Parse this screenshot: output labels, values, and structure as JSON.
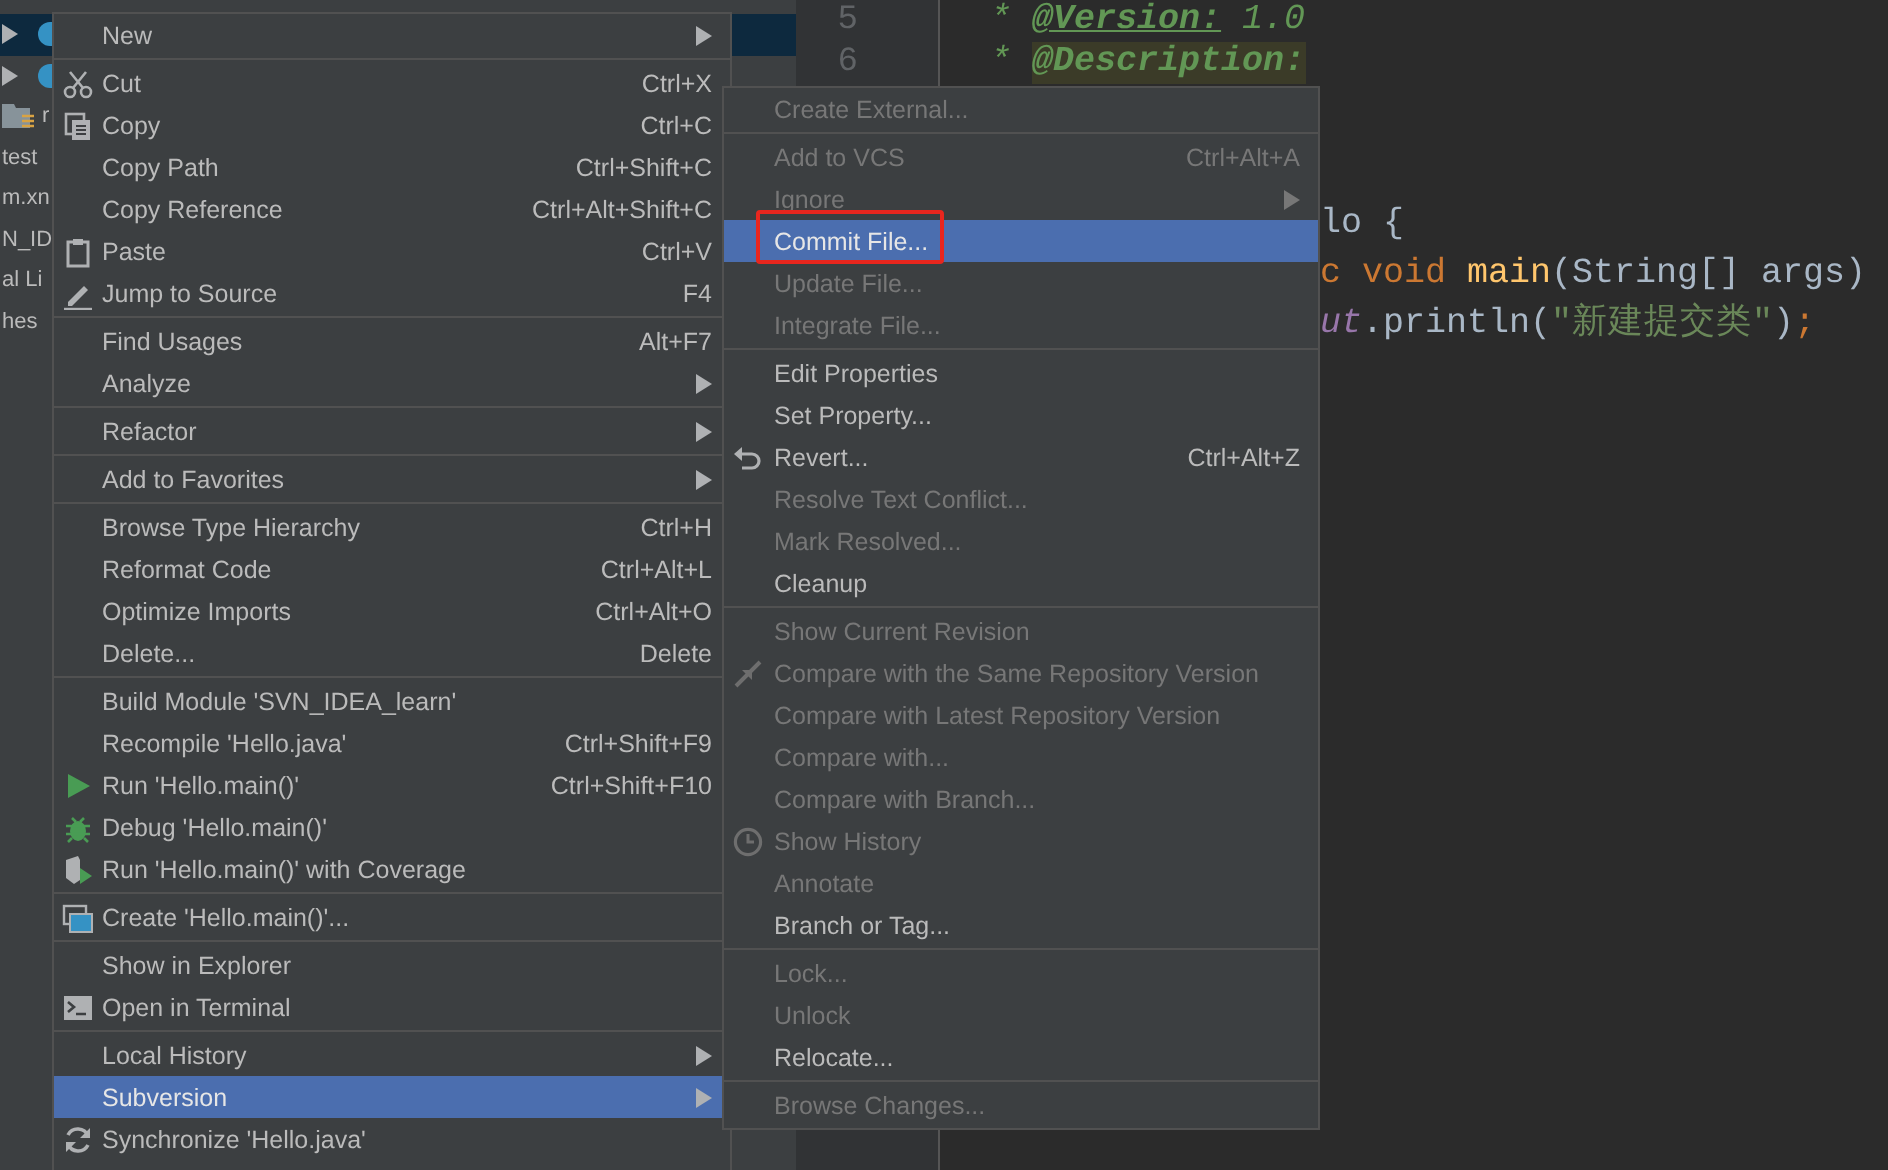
{
  "project_tree": {
    "items": [
      {
        "kind": "class",
        "expandable": true,
        "selected": true
      },
      {
        "kind": "class",
        "expandable": true,
        "selected": false
      },
      {
        "kind": "folder",
        "label": "r",
        "expandable": false,
        "selected": false
      },
      {
        "kind": "text",
        "label": "test",
        "expandable": false,
        "selected": false
      },
      {
        "kind": "text",
        "label": "m.xn",
        "expandable": false,
        "selected": false
      },
      {
        "kind": "text",
        "label": "N_ID",
        "expandable": false,
        "selected": false
      },
      {
        "kind": "text",
        "label": "al Li",
        "expandable": false,
        "selected": false
      },
      {
        "kind": "text",
        "label": "hes",
        "expandable": false,
        "selected": false
      }
    ]
  },
  "editor": {
    "line_numbers": [
      "5",
      "6"
    ],
    "lines": [
      {
        "tokens": [
          {
            "kind": "comment",
            "text": "*"
          },
          {
            "kind": "doc-tag",
            "text": "@Version:"
          },
          {
            "kind": "comment",
            "text": "1.0"
          }
        ]
      },
      {
        "tokens": [
          {
            "kind": "comment",
            "text": "*"
          },
          {
            "kind": "doc-tag-marked",
            "text": "@Description:"
          }
        ]
      },
      {
        "tokens": [
          {
            "kind": "plain",
            "text": "lo {"
          }
        ]
      },
      {
        "tokens": [
          {
            "kind": "keyword",
            "text": "c void"
          },
          {
            "kind": "function",
            "text": "main"
          },
          {
            "kind": "plain",
            "text": "(String[] args)"
          }
        ]
      },
      {
        "tokens": [
          {
            "kind": "field",
            "text": "ut"
          },
          {
            "kind": "plain",
            "text": ".println("
          },
          {
            "kind": "string",
            "text": "\"新建提交类\""
          },
          {
            "kind": "plain",
            "text": ")"
          },
          {
            "kind": "keyword",
            "text": ";"
          }
        ]
      }
    ]
  },
  "context_menu": {
    "items": [
      {
        "kind": "item",
        "label": "New",
        "submenu": true,
        "selected": false,
        "disabled": false
      },
      {
        "kind": "separator"
      },
      {
        "kind": "cut",
        "label": "Cut",
        "shortcut": "Ctrl+X",
        "submenu": false,
        "selected": false,
        "disabled": false
      },
      {
        "kind": "copy",
        "label": "Copy",
        "shortcut": "Ctrl+C",
        "submenu": false,
        "selected": false,
        "disabled": false
      },
      {
        "kind": "item",
        "label": "Copy Path",
        "shortcut": "Ctrl+Shift+C",
        "submenu": false,
        "selected": false,
        "disabled": false
      },
      {
        "kind": "item",
        "label": "Copy Reference",
        "shortcut": "Ctrl+Alt+Shift+C",
        "submenu": false,
        "selected": false,
        "disabled": false
      },
      {
        "kind": "paste",
        "label": "Paste",
        "shortcut": "Ctrl+V",
        "submenu": false,
        "selected": false,
        "disabled": false
      },
      {
        "kind": "edit",
        "label": "Jump to Source",
        "shortcut": "F4",
        "submenu": false,
        "selected": false,
        "disabled": false
      },
      {
        "kind": "separator"
      },
      {
        "kind": "item",
        "label": "Find Usages",
        "shortcut": "Alt+F7",
        "submenu": false,
        "selected": false,
        "disabled": false
      },
      {
        "kind": "item",
        "label": "Analyze",
        "submenu": true,
        "selected": false,
        "disabled": false
      },
      {
        "kind": "separator"
      },
      {
        "kind": "item",
        "label": "Refactor",
        "submenu": true,
        "selected": false,
        "disabled": false
      },
      {
        "kind": "separator"
      },
      {
        "kind": "item",
        "label": "Add to Favorites",
        "submenu": true,
        "selected": false,
        "disabled": false
      },
      {
        "kind": "separator"
      },
      {
        "kind": "item",
        "label": "Browse Type Hierarchy",
        "shortcut": "Ctrl+H",
        "submenu": false,
        "selected": false,
        "disabled": false
      },
      {
        "kind": "item",
        "label": "Reformat Code",
        "shortcut": "Ctrl+Alt+L",
        "submenu": false,
        "selected": false,
        "disabled": false
      },
      {
        "kind": "item",
        "label": "Optimize Imports",
        "shortcut": "Ctrl+Alt+O",
        "submenu": false,
        "selected": false,
        "disabled": false
      },
      {
        "kind": "item",
        "label": "Delete...",
        "shortcut": "Delete",
        "submenu": false,
        "selected": false,
        "disabled": false
      },
      {
        "kind": "separator"
      },
      {
        "kind": "item",
        "label": "Build Module 'SVN_IDEA_learn'",
        "submenu": false,
        "selected": false,
        "disabled": false
      },
      {
        "kind": "item",
        "label": "Recompile 'Hello.java'",
        "shortcut": "Ctrl+Shift+F9",
        "submenu": false,
        "selected": false,
        "disabled": false
      },
      {
        "kind": "run",
        "label": "Run 'Hello.main()'",
        "shortcut": "Ctrl+Shift+F10",
        "submenu": false,
        "selected": false,
        "disabled": false
      },
      {
        "kind": "debug",
        "label": "Debug 'Hello.main()'",
        "submenu": false,
        "selected": false,
        "disabled": false
      },
      {
        "kind": "coverage",
        "label": "Run 'Hello.main()' with Coverage",
        "submenu": false,
        "selected": false,
        "disabled": false
      },
      {
        "kind": "separator"
      },
      {
        "kind": "create",
        "label": "Create 'Hello.main()'...",
        "submenu": false,
        "selected": false,
        "disabled": false
      },
      {
        "kind": "separator"
      },
      {
        "kind": "item",
        "label": "Show in Explorer",
        "submenu": false,
        "selected": false,
        "disabled": false
      },
      {
        "kind": "terminal",
        "label": "Open in Terminal",
        "submenu": false,
        "selected": false,
        "disabled": false
      },
      {
        "kind": "separator"
      },
      {
        "kind": "item",
        "label": "Local History",
        "submenu": true,
        "selected": false,
        "disabled": false
      },
      {
        "kind": "item",
        "label": "Subversion",
        "submenu": true,
        "selected": true,
        "disabled": false
      },
      {
        "kind": "sync",
        "label": "Synchronize 'Hello.java'",
        "submenu": false,
        "selected": false,
        "disabled": false
      }
    ]
  },
  "subversion_menu": {
    "items": [
      {
        "kind": "item",
        "label": "Create External...",
        "submenu": false,
        "selected": false,
        "disabled": true
      },
      {
        "kind": "separator"
      },
      {
        "kind": "item",
        "label": "Add to VCS",
        "shortcut": "Ctrl+Alt+A",
        "submenu": false,
        "selected": false,
        "disabled": true
      },
      {
        "kind": "item",
        "label": "Ignore",
        "submenu": true,
        "selected": false,
        "disabled": true
      },
      {
        "kind": "item",
        "label": "Commit File...",
        "submenu": false,
        "selected": true,
        "disabled": false,
        "annotated": true
      },
      {
        "kind": "item",
        "label": "Update File...",
        "submenu": false,
        "selected": false,
        "disabled": true
      },
      {
        "kind": "item",
        "label": "Integrate File...",
        "submenu": false,
        "selected": false,
        "disabled": true
      },
      {
        "kind": "separator"
      },
      {
        "kind": "item",
        "label": "Edit Properties",
        "submenu": false,
        "selected": false,
        "disabled": false
      },
      {
        "kind": "item",
        "label": "Set Property...",
        "submenu": false,
        "selected": false,
        "disabled": false
      },
      {
        "kind": "revert",
        "label": "Revert...",
        "shortcut": "Ctrl+Alt+Z",
        "submenu": false,
        "selected": false,
        "disabled": false
      },
      {
        "kind": "item",
        "label": "Resolve Text Conflict...",
        "submenu": false,
        "selected": false,
        "disabled": true
      },
      {
        "kind": "item",
        "label": "Mark Resolved...",
        "submenu": false,
        "selected": false,
        "disabled": true
      },
      {
        "kind": "item",
        "label": "Cleanup",
        "submenu": false,
        "selected": false,
        "disabled": false
      },
      {
        "kind": "separator"
      },
      {
        "kind": "item",
        "label": "Show Current Revision",
        "submenu": false,
        "selected": false,
        "disabled": true
      },
      {
        "kind": "compare",
        "label": "Compare with the Same Repository Version",
        "submenu": false,
        "selected": false,
        "disabled": true
      },
      {
        "kind": "item",
        "label": "Compare with Latest Repository Version",
        "submenu": false,
        "selected": false,
        "disabled": true
      },
      {
        "kind": "item",
        "label": "Compare with...",
        "submenu": false,
        "selected": false,
        "disabled": true
      },
      {
        "kind": "item",
        "label": "Compare with Branch...",
        "submenu": false,
        "selected": false,
        "disabled": true
      },
      {
        "kind": "history",
        "label": "Show History",
        "submenu": false,
        "selected": false,
        "disabled": true
      },
      {
        "kind": "item",
        "label": "Annotate",
        "submenu": false,
        "selected": false,
        "disabled": true
      },
      {
        "kind": "item",
        "label": "Branch or Tag...",
        "submenu": false,
        "selected": false,
        "disabled": false
      },
      {
        "kind": "separator"
      },
      {
        "kind": "item",
        "label": "Lock...",
        "submenu": false,
        "selected": false,
        "disabled": true
      },
      {
        "kind": "item",
        "label": "Unlock",
        "submenu": false,
        "selected": false,
        "disabled": true
      },
      {
        "kind": "item",
        "label": "Relocate...",
        "submenu": false,
        "selected": false,
        "disabled": false
      },
      {
        "kind": "separator"
      },
      {
        "kind": "item",
        "label": "Browse Changes...",
        "submenu": false,
        "selected": false,
        "disabled": true
      }
    ]
  }
}
